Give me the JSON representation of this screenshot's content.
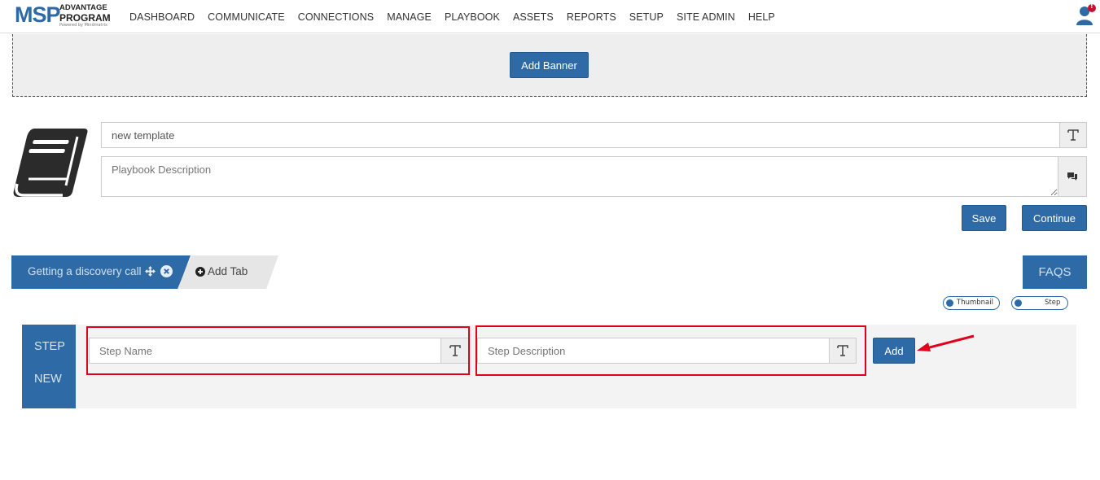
{
  "logo": {
    "brand": "MSP",
    "line1": "ADVANTAGE",
    "line2": "PROGRAM",
    "powered": "Powered by Mindmatrix"
  },
  "nav": {
    "items": [
      "DASHBOARD",
      "COMMUNICATE",
      "CONNECTIONS",
      "MANAGE",
      "PLAYBOOK",
      "ASSETS",
      "REPORTS",
      "SETUP",
      "SITE ADMIN",
      "HELP"
    ]
  },
  "user": {
    "notification_badge": "!"
  },
  "banner": {
    "add_banner_label": "Add Banner"
  },
  "playbook": {
    "title_value": "new template",
    "description_placeholder": "Playbook Description",
    "save_label": "Save",
    "continue_label": "Continue"
  },
  "tabs": {
    "active_tab_label": "Getting a discovery call",
    "add_tab_label": "Add Tab",
    "faqs_label": "FAQS"
  },
  "toggles": {
    "thumbnail_label": "Thumbnail",
    "step_label": "Step"
  },
  "step": {
    "side_line1": "STEP",
    "side_line2": "NEW",
    "name_placeholder": "Step Name",
    "description_placeholder": "Step Description",
    "add_label": "Add"
  },
  "colors": {
    "primary": "#2d6aa6",
    "highlight": "#e0001b",
    "banner_bg": "#eeeeee",
    "step_bg": "#f3f3f3"
  }
}
